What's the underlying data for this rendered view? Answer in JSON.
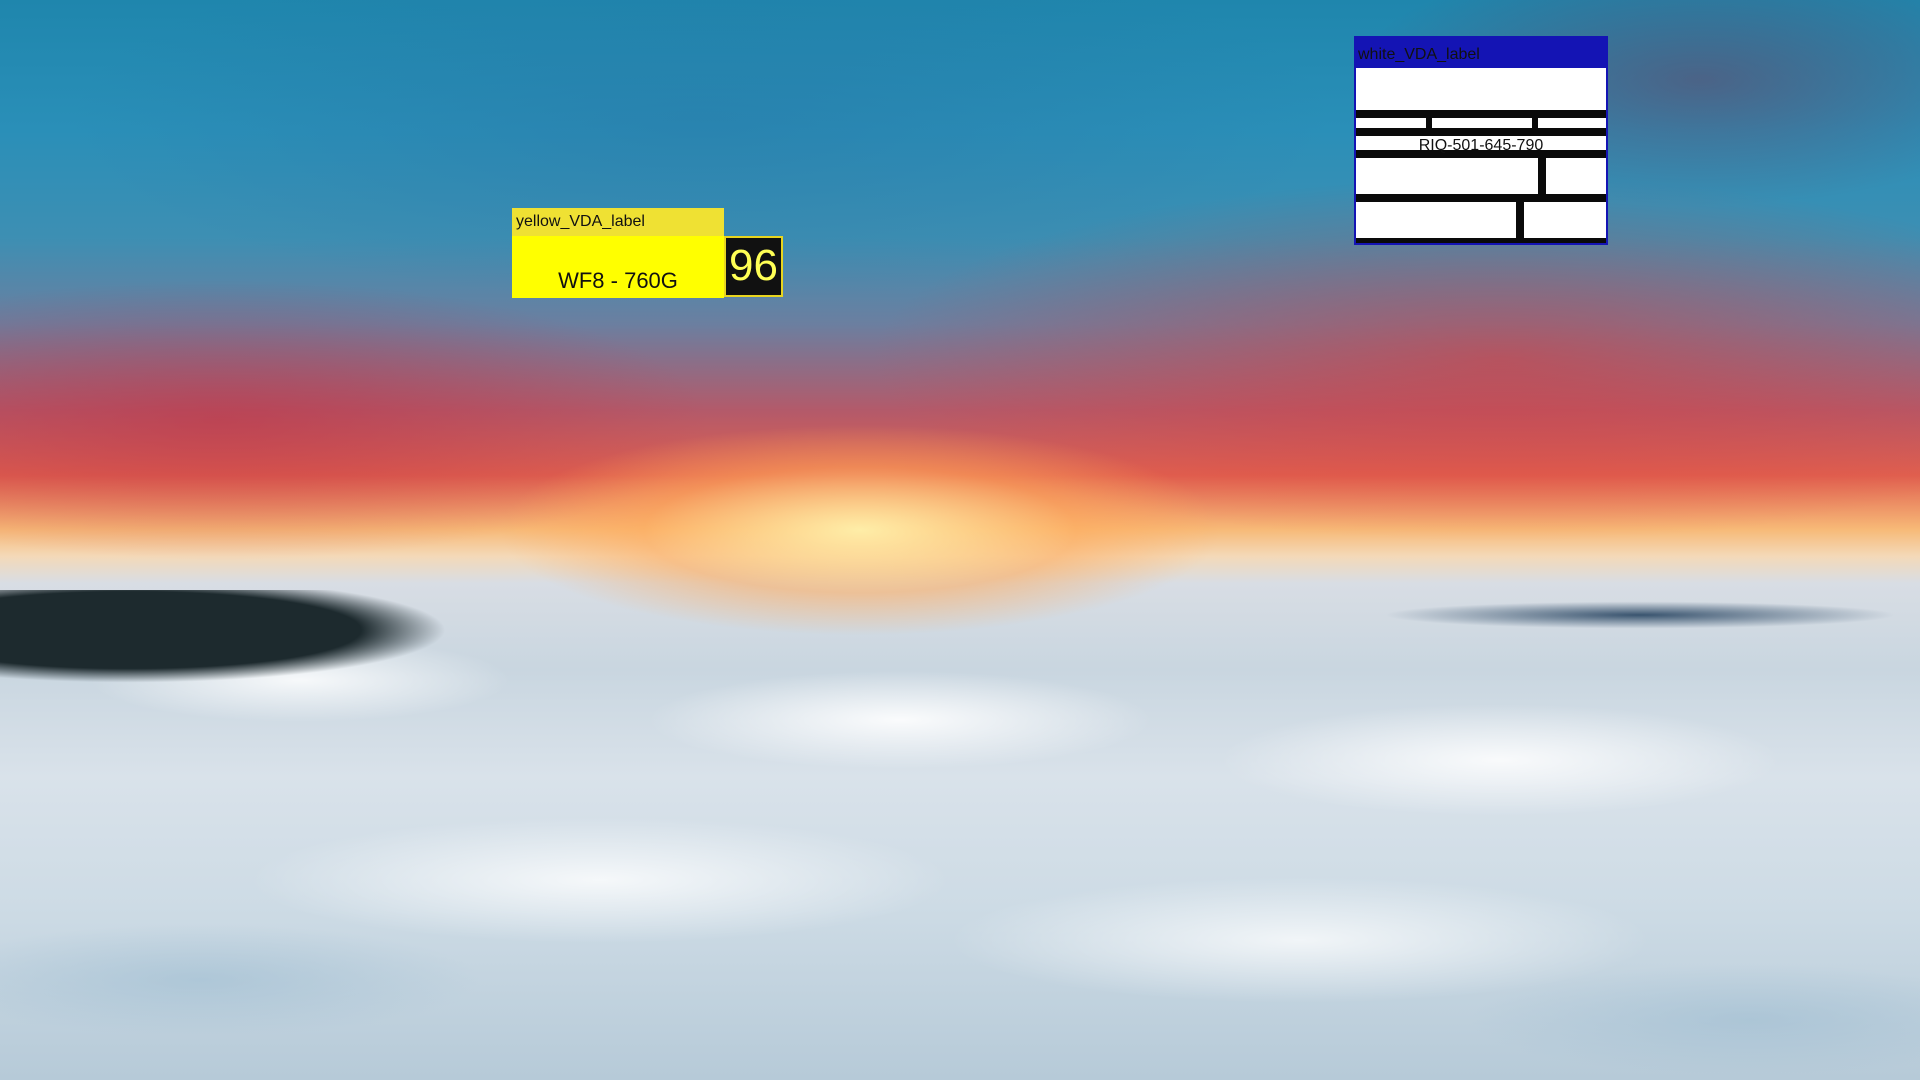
{
  "background": {
    "description_icon": "sunset-above-clouds-wallpaper",
    "colors": {
      "sky_top": "#1f86ad",
      "sunset_red": "#e0604f",
      "sun_glow": "#f7b977",
      "cloud_sea": "#d9e2ea"
    }
  },
  "yellow_label": {
    "title": "yellow_VDA_label",
    "main_text": "WF8 - 760G",
    "number": "96",
    "colors": {
      "header": "#efe133",
      "body": "#ffff00",
      "number_box": "#111111",
      "number_text": "#ffff55"
    }
  },
  "white_label": {
    "title": "white_VDA_label",
    "code": "RIQ-501-645-790",
    "colors": {
      "header": "#1414b4",
      "cells": "#ffffff",
      "grid_lines": "#0a0a0a"
    }
  }
}
